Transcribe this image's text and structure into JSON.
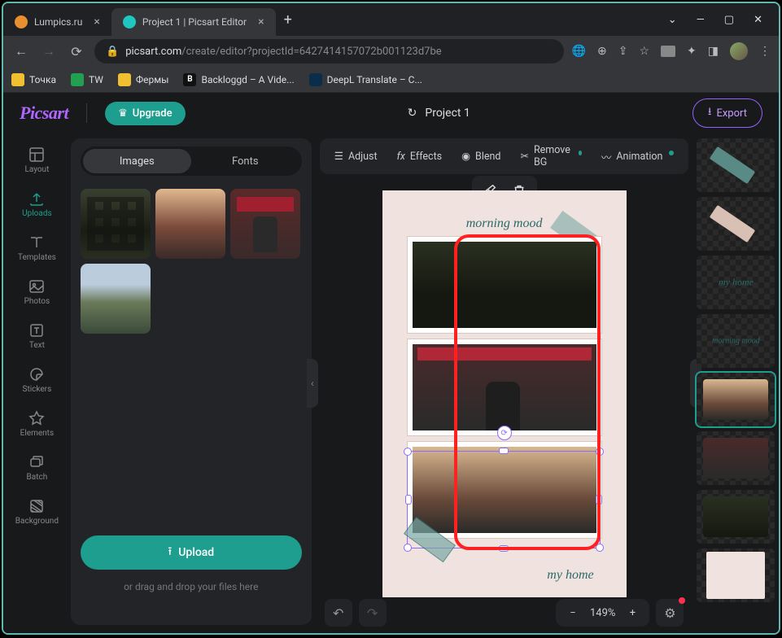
{
  "browser": {
    "tabs": [
      {
        "title": "Lumpics.ru",
        "favicon_color": "#e89030",
        "active": false
      },
      {
        "title": "Project 1 | Picsart Editor",
        "favicon_color": "#1ec8c0",
        "active": true
      }
    ],
    "url_host": "picsart.com",
    "url_path": "/create/editor?projectId=6427414157072b001123d7be",
    "bookmarks": [
      {
        "label": "Точка",
        "color": "#f0c030"
      },
      {
        "label": "TW",
        "color": "#20a050"
      },
      {
        "label": "Фермы",
        "color": "#f0c030"
      },
      {
        "label": "Backloggd – A Vide...",
        "color": "#ffffff"
      },
      {
        "label": "DeepL Translate – С...",
        "color": "#0a2d4a"
      }
    ]
  },
  "header": {
    "logo": "Picsart",
    "upgrade_label": "Upgrade",
    "project_name": "Project 1",
    "export_label": "Export"
  },
  "rail": {
    "items": [
      {
        "label": "Layout"
      },
      {
        "label": "Uploads"
      },
      {
        "label": "Templates"
      },
      {
        "label": "Photos"
      },
      {
        "label": "Text"
      },
      {
        "label": "Stickers"
      },
      {
        "label": "Elements"
      },
      {
        "label": "Batch"
      },
      {
        "label": "Background"
      }
    ],
    "active": "Uploads"
  },
  "panel": {
    "seg_images": "Images",
    "seg_fonts": "Fonts",
    "upload_label": "Upload",
    "drag_hint": "or drag and drop your files here"
  },
  "toolbar": {
    "adjust": "Adjust",
    "effects": "Effects",
    "blend": "Blend",
    "removebg": "Remove BG",
    "animation": "Animation"
  },
  "canvas": {
    "title_top": "morning mood",
    "title_bottom": "my home",
    "zoom": "149%"
  },
  "layers": {
    "text1": "my home",
    "text2": "morning mood"
  }
}
